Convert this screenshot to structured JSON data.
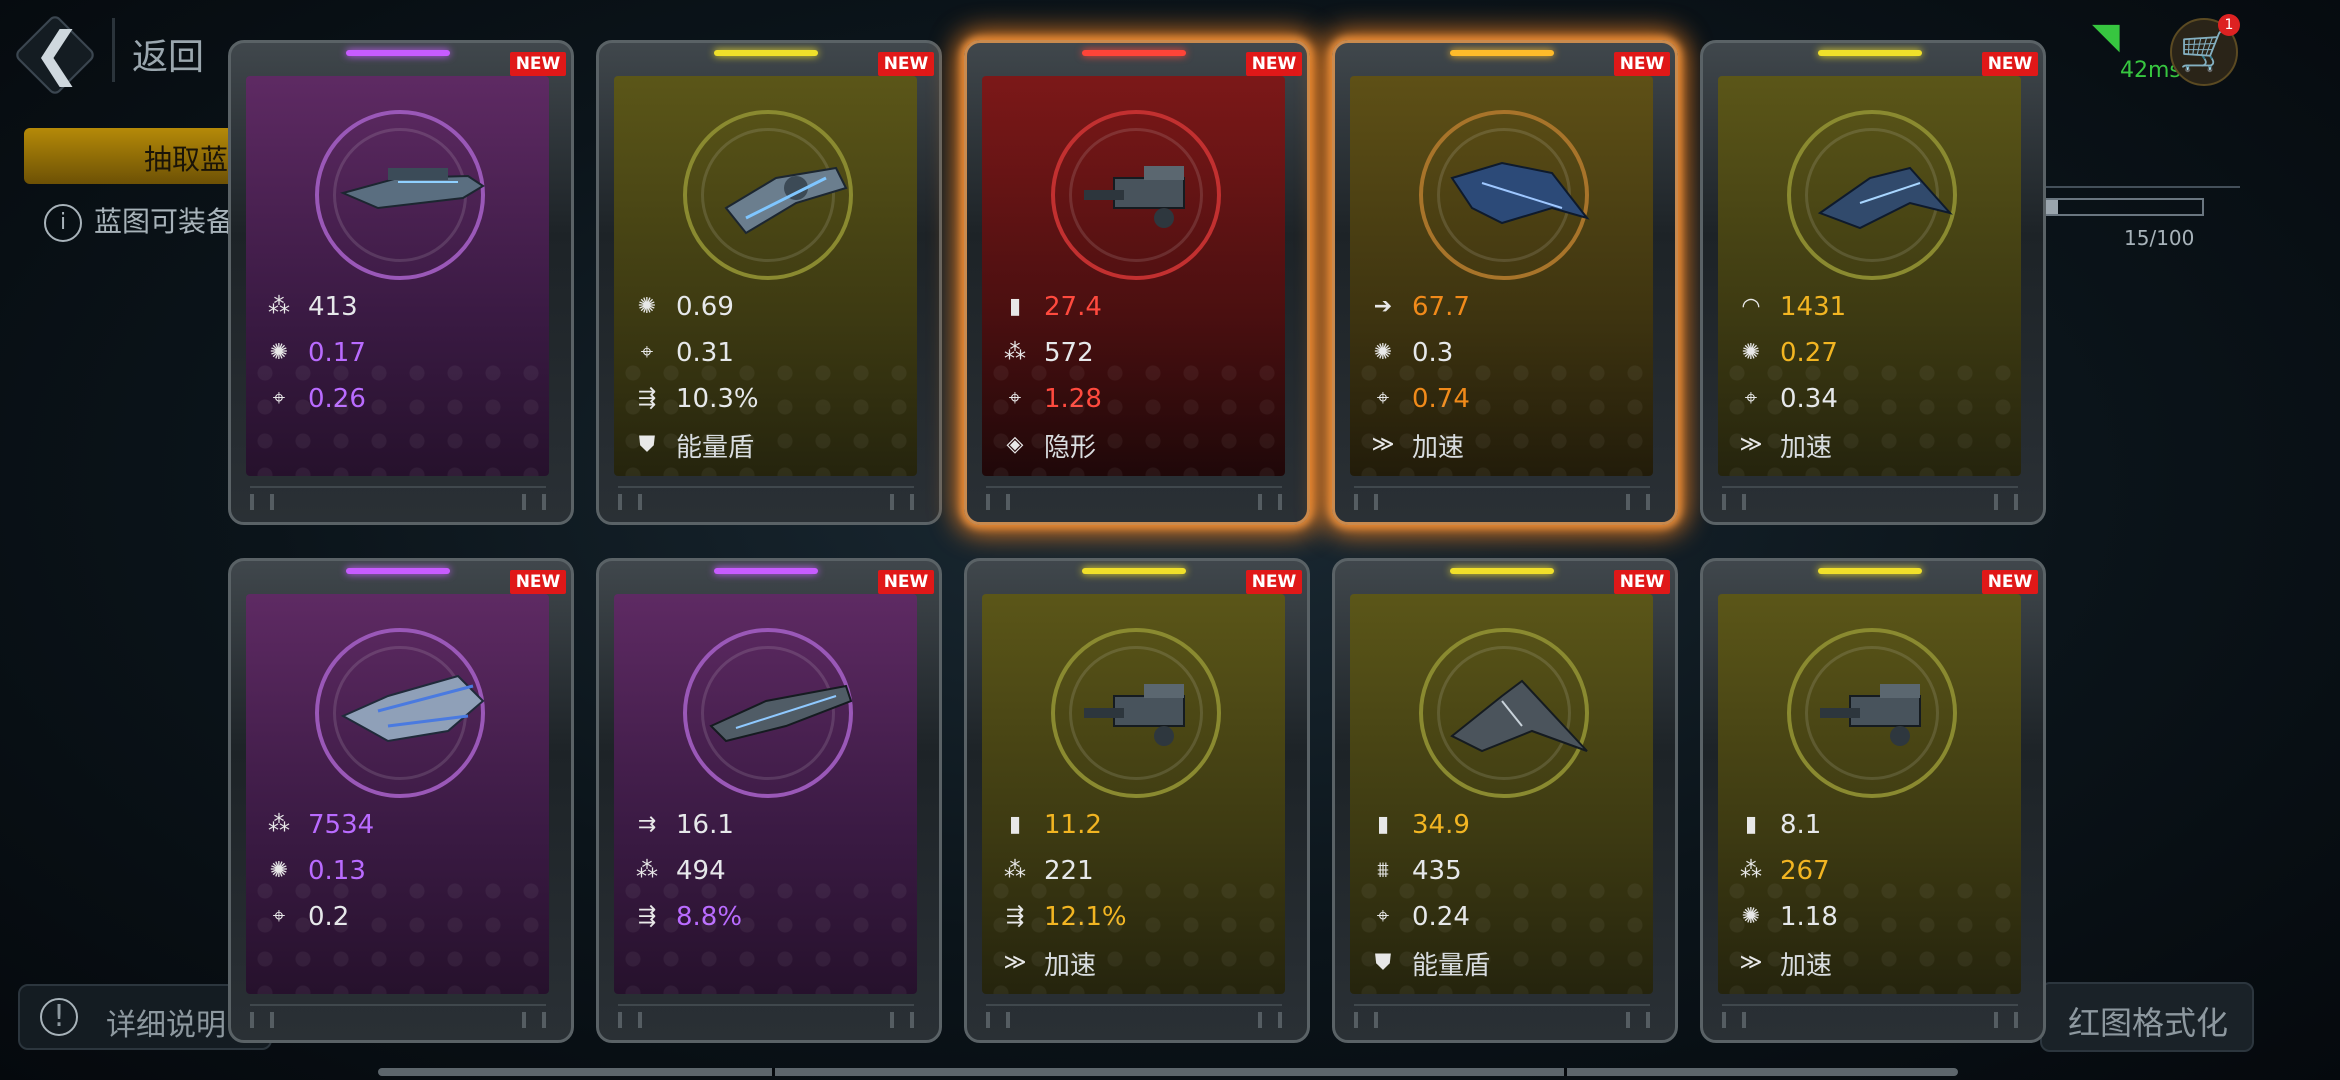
{
  "header": {
    "back_label": "返回",
    "ping": "42ms",
    "cart_badge": "1"
  },
  "tabs": {
    "draw_label": "抽取蓝"
  },
  "info_text": "蓝图可装备",
  "progress": {
    "text": "15/100",
    "fraction": 0.15
  },
  "footer": {
    "details_label": "详细说明",
    "format_label": "红图格式化"
  },
  "colors": {
    "purple": "#b96bff",
    "gold": "#f2b522",
    "orange": "#f08a1a",
    "red": "#ff4a3e",
    "new_badge": "#e01818"
  },
  "cards": [
    {
      "rarity": "purple",
      "badge": "NEW",
      "stats": [
        {
          "icon": "cluster-icon",
          "value": "413",
          "color": "white"
        },
        {
          "icon": "gear-icon",
          "value": "0.17",
          "color": "purple"
        },
        {
          "icon": "crosshair-icon",
          "value": "0.26",
          "color": "purple"
        }
      ]
    },
    {
      "rarity": "olive",
      "badge": "NEW",
      "stats": [
        {
          "icon": "gear-icon",
          "value": "0.69",
          "color": "white"
        },
        {
          "icon": "crosshair-icon",
          "value": "0.31",
          "color": "white"
        },
        {
          "icon": "missile-icon",
          "value": "10.3%",
          "color": "white"
        },
        {
          "icon": "shield-icon",
          "value": "能量盾",
          "color": "label"
        }
      ]
    },
    {
      "rarity": "red",
      "badge": "NEW",
      "stats": [
        {
          "icon": "ammo-icon",
          "value": "27.4",
          "color": "red"
        },
        {
          "icon": "cluster-icon",
          "value": "572",
          "color": "white"
        },
        {
          "icon": "crosshair-icon",
          "value": "1.28",
          "color": "red"
        },
        {
          "icon": "stealth-icon",
          "value": "隐形",
          "color": "label"
        }
      ]
    },
    {
      "rarity": "amber",
      "badge": "NEW",
      "stats": [
        {
          "icon": "arrow-icon",
          "value": "67.7",
          "color": "orange"
        },
        {
          "icon": "gear-icon",
          "value": "0.3",
          "color": "white"
        },
        {
          "icon": "crosshair-icon",
          "value": "0.74",
          "color": "orange"
        },
        {
          "icon": "boost-icon",
          "value": "加速",
          "color": "label"
        }
      ]
    },
    {
      "rarity": "olive",
      "badge": "NEW",
      "stats": [
        {
          "icon": "armor-icon",
          "value": "1431",
          "color": "gold"
        },
        {
          "icon": "gear-icon",
          "value": "0.27",
          "color": "gold"
        },
        {
          "icon": "crosshair-icon",
          "value": "0.34",
          "color": "white"
        },
        {
          "icon": "boost-icon",
          "value": "加速",
          "color": "label"
        }
      ]
    },
    {
      "rarity": "purple",
      "badge": "NEW",
      "stats": [
        {
          "icon": "cluster-icon",
          "value": "7534",
          "color": "purple"
        },
        {
          "icon": "gear-icon",
          "value": "0.13",
          "color": "purple"
        },
        {
          "icon": "crosshair-icon",
          "value": "0.2",
          "color": "white"
        }
      ]
    },
    {
      "rarity": "purple",
      "badge": "NEW",
      "stats": [
        {
          "icon": "thrust-icon",
          "value": "16.1",
          "color": "white"
        },
        {
          "icon": "cluster-icon",
          "value": "494",
          "color": "white"
        },
        {
          "icon": "missile-icon",
          "value": "8.8%",
          "color": "purple"
        }
      ]
    },
    {
      "rarity": "olive",
      "badge": "NEW",
      "stats": [
        {
          "icon": "ammo-icon",
          "value": "11.2",
          "color": "gold"
        },
        {
          "icon": "cluster-icon",
          "value": "221",
          "color": "white"
        },
        {
          "icon": "missile-icon",
          "value": "12.1%",
          "color": "gold"
        },
        {
          "icon": "boost-icon",
          "value": "加速",
          "color": "label"
        }
      ]
    },
    {
      "rarity": "olive",
      "badge": "NEW",
      "stats": [
        {
          "icon": "ammo-icon",
          "value": "34.9",
          "color": "gold"
        },
        {
          "icon": "fleet-icon",
          "value": "435",
          "color": "white"
        },
        {
          "icon": "crosshair-icon",
          "value": "0.24",
          "color": "white"
        },
        {
          "icon": "shield-icon",
          "value": "能量盾",
          "color": "label"
        }
      ]
    },
    {
      "rarity": "olive",
      "badge": "NEW",
      "stats": [
        {
          "icon": "ammo-icon",
          "value": "8.1",
          "color": "white"
        },
        {
          "icon": "cluster-icon",
          "value": "267",
          "color": "gold"
        },
        {
          "icon": "gear-icon",
          "value": "1.18",
          "color": "white"
        },
        {
          "icon": "boost-icon",
          "value": "加速",
          "color": "label"
        }
      ]
    }
  ]
}
